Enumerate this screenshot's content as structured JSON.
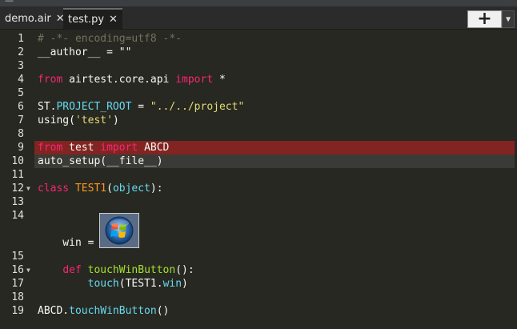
{
  "window": {
    "title_fragment": "—"
  },
  "tabs": [
    {
      "label": "demo.air",
      "close": "✕",
      "active": false
    },
    {
      "label": "test.py",
      "close": "✕",
      "active": true
    }
  ],
  "toolbar": {
    "add_icon": "+",
    "dropdown_icon": "▼"
  },
  "colors": {
    "background": "#272822",
    "error_line": "#822522",
    "keyword": "#f92672",
    "string": "#e6db74",
    "builtin": "#66d9ef",
    "class_name": "#fd971f",
    "function": "#a6e22e",
    "comment": "#75715e"
  },
  "code": {
    "line_numbers": [
      "1",
      "2",
      "3",
      "4",
      "5",
      "6",
      "7",
      "8",
      "9",
      "10",
      "11",
      "12",
      "13",
      "14",
      "15",
      "16",
      "17",
      "18",
      "19"
    ],
    "l1": "# -*- encoding=utf8 -*-",
    "l2": "__author__ = \"\"",
    "l4_kw1": "from",
    "l4_mod": " airtest.core.api ",
    "l4_kw2": "import",
    "l4_rest": " *",
    "l6_a": "ST.",
    "l6_b": "PROJECT_ROOT",
    "l6_c": " = ",
    "l6_d": "\"../../project\"",
    "l7_a": "using(",
    "l7_b": "'test'",
    "l7_c": ")",
    "l9_kw1": "from",
    "l9_mid": " test ",
    "l9_kw2": "import",
    "l9_rest": " ABCD",
    "l10": "auto_setup(__file__)",
    "l12_kw": "class",
    "l12_name": " TEST1",
    "l12_a": "(",
    "l12_b": "object",
    "l12_c": "):",
    "l14_text": "    win = ",
    "l14_image_icon": "windows-start-button-image",
    "l16_kw": "def",
    "l16_name": " touchWinButton",
    "l16_rest": "():",
    "l17_a": "        ",
    "l17_b": "touch",
    "l17_c": "(TEST1.",
    "l17_d": "win",
    "l17_e": ")",
    "l19_a": "ABCD.",
    "l19_b": "touchWinButton",
    "l19_c": "()"
  }
}
